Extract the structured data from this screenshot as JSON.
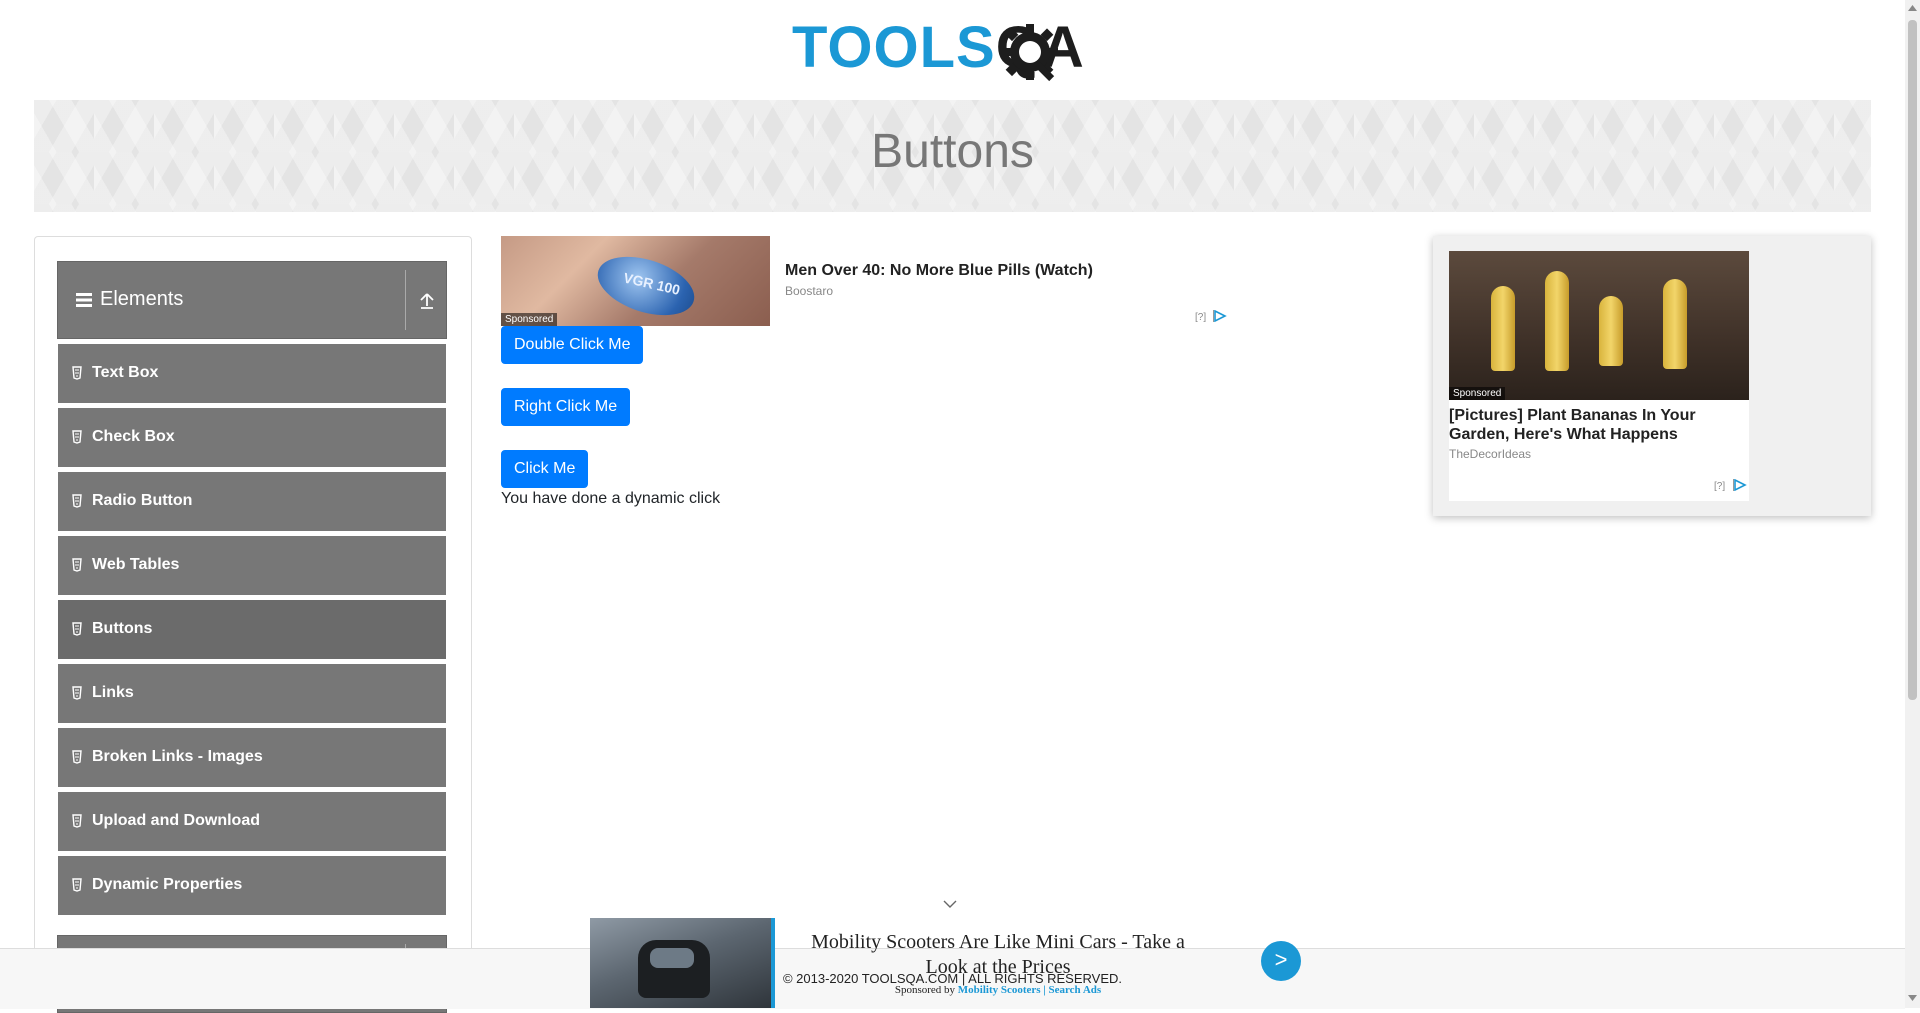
{
  "header": {
    "logo_text_tools": "TOOLS",
    "logo_text_qa": "QA"
  },
  "page": {
    "title": "Buttons"
  },
  "sidebar": {
    "group_title": "Elements",
    "items": [
      {
        "label": "Text Box"
      },
      {
        "label": "Check Box"
      },
      {
        "label": "Radio Button"
      },
      {
        "label": "Web Tables"
      },
      {
        "label": "Buttons",
        "active": true
      },
      {
        "label": "Links"
      },
      {
        "label": "Broken Links - Images"
      },
      {
        "label": "Upload and Download"
      },
      {
        "label": "Dynamic Properties"
      }
    ]
  },
  "main": {
    "double_click_label": "Double Click Me",
    "right_click_label": "Right Click Me",
    "click_me_label": "Click Me",
    "dynamic_message": "You have done a dynamic click"
  },
  "ads": {
    "top": {
      "title": "Men Over 40: No More Blue Pills (Watch)",
      "source": "Boostaro",
      "sponsored": "Sponsored",
      "pill_text": "VGR 100",
      "help": "[?]"
    },
    "right": {
      "title": "[Pictures] Plant Bananas In Your Garden, Here's What Happens",
      "source": "TheDecorIdeas",
      "sponsored": "Sponsored",
      "help": "[?]"
    },
    "bottom": {
      "title": "Mobility Scooters Are Like Mini Cars - Take a Look at the Prices",
      "sponsored_by": "Sponsored by",
      "sponsor_link": "Mobility Scooters | Search Ads",
      "next": ">"
    }
  },
  "footer": {
    "copyright": "© 2013-2020 TOOLSQA.COM | ALL RIGHTS RESERVED."
  },
  "colors": {
    "primary_button": "#007bff",
    "sidebar_bg": "#777777",
    "brand_blue": "#1b98d5"
  }
}
